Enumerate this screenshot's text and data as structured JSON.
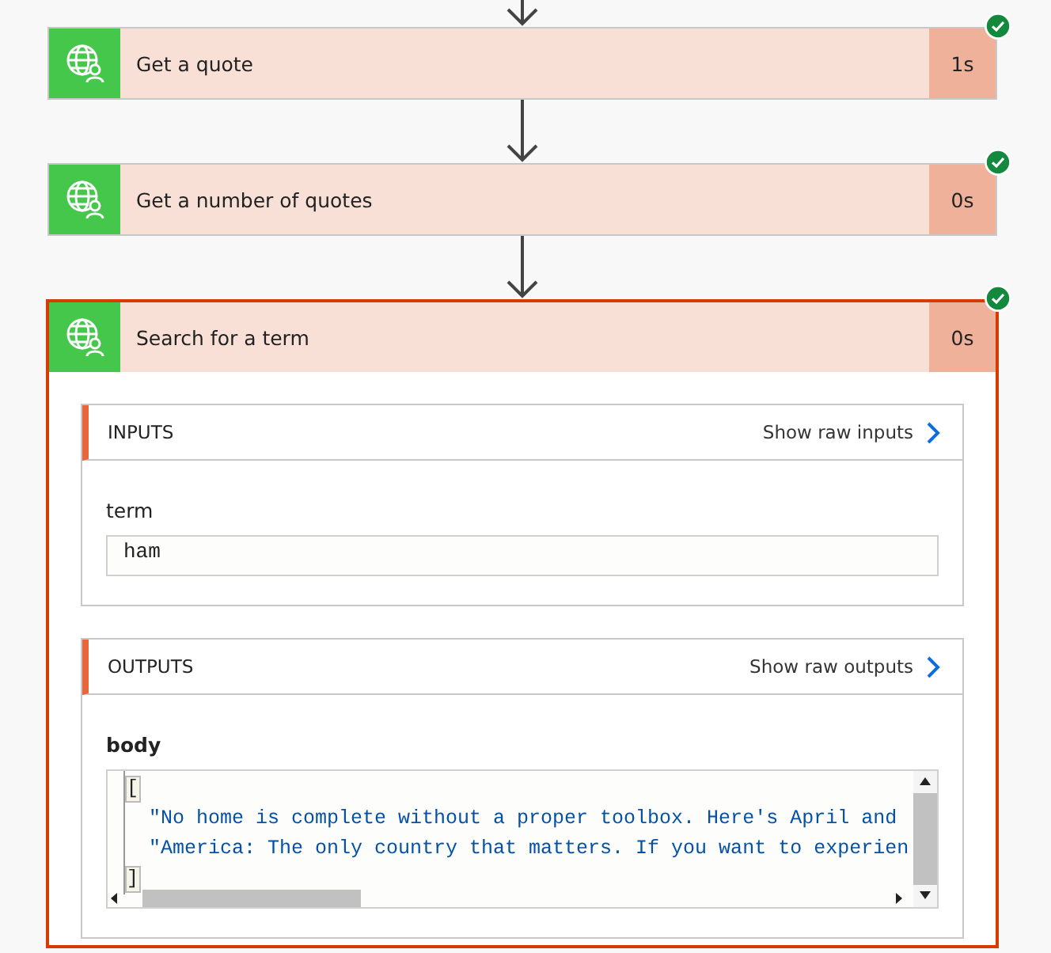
{
  "steps": [
    {
      "title": "Get a quote",
      "duration": "1s",
      "succeeded": true,
      "expanded": false
    },
    {
      "title": "Get a number of quotes",
      "duration": "0s",
      "succeeded": true,
      "expanded": false
    },
    {
      "title": "Search for a term",
      "duration": "0s",
      "succeeded": true,
      "expanded": true,
      "sections": [
        {
          "header": "INPUTS",
          "raw_link": "Show raw inputs",
          "fields": [
            {
              "label": "term",
              "kind": "text",
              "value": "ham"
            }
          ]
        },
        {
          "header": "OUTPUTS",
          "raw_link": "Show raw outputs",
          "fields": [
            {
              "label": "body",
              "kind": "code",
              "lines": [
                "[",
                "  \"No home is complete without a proper toolbox. Here's April and",
                "  \"America: The only country that matters. If you want to experien",
                "]"
              ]
            }
          ]
        }
      ]
    }
  ]
}
